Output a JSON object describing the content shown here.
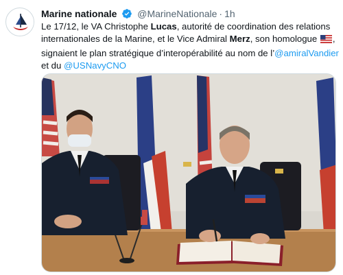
{
  "account": {
    "display_name": "Marine nationale",
    "handle": "@MarineNationale",
    "separator": "·",
    "time": "1h",
    "avatar_icon": "marine-nationale-logo-icon",
    "verified_icon": "verified-badge-icon"
  },
  "tweet": {
    "t1": "Le 17/12, le VA Christophe ",
    "name1": "Lucas",
    "t2": ", autorité de coordination des relations internationales de la Marine, et le Vice Admiral ",
    "name2": "Merz",
    "t3": ", son homologue ",
    "t4": ", signaient le plan stratégique d’interopérabilité au nom de l’",
    "mention1": "@amiralVandier",
    "t5": " et du ",
    "mention2": "@USNavyCNO",
    "flag_icon": "us-flag-emoji-icon"
  },
  "media": {
    "description_icon": "signing-ceremony-photo"
  },
  "colors": {
    "link": "#1d9bf0",
    "text": "#0f1419",
    "secondary": "#536471",
    "border": "#cfd9de",
    "navy": "#1a2a44"
  }
}
